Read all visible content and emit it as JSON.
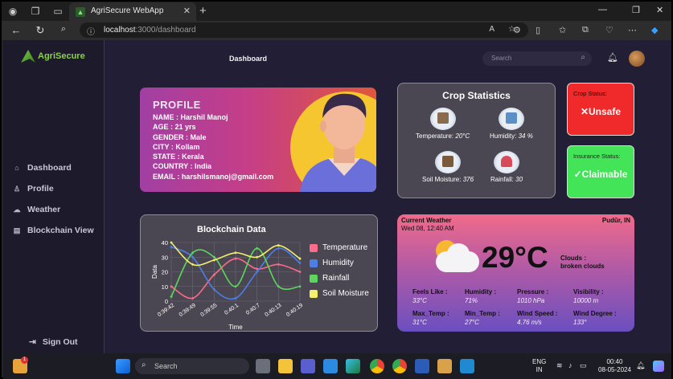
{
  "browser": {
    "tab_title": "AgriSecure WebApp",
    "url_host": "localhost",
    "url_path": ":3000/dashboard"
  },
  "app": {
    "logo": "AgriSecure",
    "header_title": "Dashboard",
    "search_placeholder": "Search"
  },
  "sidebar": {
    "items": [
      {
        "label": "Dashboard",
        "icon": "home-icon"
      },
      {
        "label": "Profile",
        "icon": "person-icon"
      },
      {
        "label": "Weather",
        "icon": "cloud-icon"
      },
      {
        "label": "Blockchain View",
        "icon": "ledger-icon"
      }
    ],
    "sign_out": "Sign Out"
  },
  "profile": {
    "title": "PROFILE",
    "name": "NAME : Harshil Manoj",
    "age": "AGE : 21 yrs",
    "gender": "GENDER : Male",
    "city": "CITY : Kollam",
    "state": "STATE : Kerala",
    "country": "COUNTRY : India",
    "email": "EMAIL : harshilsmanoj@gmail.com"
  },
  "crop_stats": {
    "title": "Crop Statistics",
    "temperature_label": "Temperature:",
    "temperature": "20°C",
    "humidity_label": "Humidity:",
    "humidity": "34 %",
    "soil_label": "Soil Moisture:",
    "soil": "376",
    "rainfall_label": "Rainfall:",
    "rainfall": "30"
  },
  "crop_status": {
    "label": "Crop Status:",
    "value": "Unsafe",
    "mark": "✕",
    "color": "#f02a2a"
  },
  "insurance_status": {
    "label": "Insurance Status:",
    "value": "Claimable",
    "mark": "✓",
    "color": "#43e457"
  },
  "chart_data": {
    "type": "line",
    "title": "Blockchain Data",
    "xlabel": "Time",
    "ylabel": "Data",
    "x": [
      "0:39:42",
      "0:39:49",
      "0:39:55",
      "0:40:1",
      "0:40:7",
      "0:40:13",
      "0:40:19"
    ],
    "ylim": [
      0,
      40
    ],
    "yticks": [
      0,
      10,
      20,
      30,
      40
    ],
    "grid": true,
    "legend_position": "right",
    "series": [
      {
        "name": "Temperature",
        "color": "#ff6b8b",
        "values": [
          10,
          2,
          18,
          29,
          22,
          25,
          20
        ]
      },
      {
        "name": "Humidity",
        "color": "#4d7ee8",
        "values": [
          37,
          30,
          8,
          2,
          20,
          36,
          26
        ]
      },
      {
        "name": "Rainfall",
        "color": "#5bd85b",
        "values": [
          3,
          33,
          30,
          10,
          36,
          10,
          10
        ]
      },
      {
        "name": "Soil Moisture",
        "color": "#f5ef6e",
        "values": [
          40,
          25,
          28,
          33,
          30,
          38,
          29
        ]
      }
    ]
  },
  "weather": {
    "heading": "Current Weather",
    "datetime": "Wed 08, 12:40 AM",
    "location": "Pudūr, IN",
    "temp": "29°C",
    "clouds_label": "Clouds :",
    "clouds_desc": "broken clouds",
    "details": [
      {
        "label": "Feels Like :",
        "value": "33°C"
      },
      {
        "label": "Humidity :",
        "value": "71%"
      },
      {
        "label": "Pressure :",
        "value": "1010 hPa"
      },
      {
        "label": "Visibility :",
        "value": "10000 m"
      },
      {
        "label": "Max_Temp :",
        "value": "31°C"
      },
      {
        "label": "Min_Temp :",
        "value": "27°C"
      },
      {
        "label": "Wind Speed :",
        "value": "4.76 m/s"
      },
      {
        "label": "Wind Degree :",
        "value": "133°"
      }
    ]
  },
  "taskbar": {
    "search": "Search",
    "lang1": "ENG",
    "lang2": "IN",
    "time": "00:40",
    "date": "08-05-2024",
    "badge": "1"
  }
}
